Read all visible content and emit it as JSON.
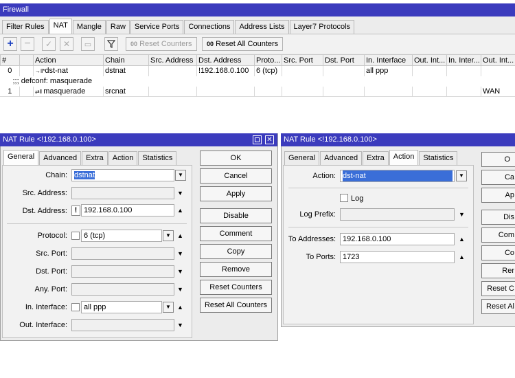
{
  "window": {
    "title": "Firewall"
  },
  "tabs": [
    "Filter Rules",
    "NAT",
    "Mangle",
    "Raw",
    "Service Ports",
    "Connections",
    "Address Lists",
    "Layer7 Protocols"
  ],
  "toolbar": {
    "reset_counters": "Reset Counters",
    "reset_all_counters": "Reset All Counters",
    "counters_icon": "00"
  },
  "table": {
    "headers": [
      "#",
      "",
      "Action",
      "Chain",
      "Src. Address",
      "Dst. Address",
      "Proto...",
      "Src. Port",
      "Dst. Port",
      "In. Interface",
      "Out. Int...",
      "In. Inter...",
      "Out. Int..."
    ],
    "rows": [
      {
        "num": "0",
        "action": "dst-nat",
        "chain": "dstnat",
        "dst": "!192.168.0.100",
        "proto": "6 (tcp)",
        "in_if": "all ppp",
        "out_if": ""
      },
      {
        "num": "1",
        "action": "masquerade",
        "chain": "srcnat",
        "dst": "",
        "proto": "",
        "in_if": "",
        "out_if": "WAN"
      }
    ],
    "comment": ";;; defconf: masquerade"
  },
  "left_dialog": {
    "title": "NAT Rule <!192.168.0.100>",
    "tabs": [
      "General",
      "Advanced",
      "Extra",
      "Action",
      "Statistics"
    ],
    "labels": {
      "chain": "Chain:",
      "src_address": "Src. Address:",
      "dst_address": "Dst. Address:",
      "protocol": "Protocol:",
      "src_port": "Src. Port:",
      "dst_port": "Dst. Port:",
      "any_port": "Any. Port:",
      "in_interface": "In. Interface:",
      "out_interface": "Out. Interface:"
    },
    "values": {
      "chain": "dstnat",
      "dst_address": "192.168.0.100",
      "dst_negate": "!",
      "protocol": "6 (tcp)",
      "in_interface": "all ppp"
    },
    "buttons": [
      "OK",
      "Cancel",
      "Apply",
      "Disable",
      "Comment",
      "Copy",
      "Remove",
      "Reset Counters",
      "Reset All Counters"
    ]
  },
  "right_dialog": {
    "title": "NAT Rule <!192.168.0.100>",
    "tabs": [
      "General",
      "Advanced",
      "Extra",
      "Action",
      "Statistics"
    ],
    "labels": {
      "action": "Action:",
      "log": "Log",
      "log_prefix": "Log Prefix:",
      "to_addresses": "To Addresses:",
      "to_ports": "To Ports:"
    },
    "values": {
      "action": "dst-nat",
      "to_addresses": "192.168.0.100",
      "to_ports": "1723"
    },
    "buttons": [
      "O",
      "Ca",
      "Ap",
      "Dis",
      "Com",
      "Co",
      "Rer",
      "Reset C",
      "Reset Al"
    ]
  }
}
